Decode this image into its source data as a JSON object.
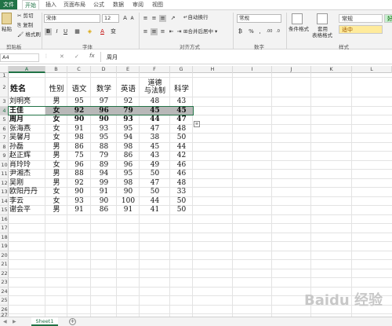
{
  "tabs": [
    "文件",
    "开始",
    "插入",
    "页面布局",
    "公式",
    "数据",
    "审阅",
    "视图"
  ],
  "ribbon": {
    "cut": "剪切",
    "paste": "粘贴",
    "copy": "复制",
    "format_painter": "格式刷",
    "font_name": "宋体",
    "font_size": "12",
    "bold": "B",
    "italic": "I",
    "underline": "U",
    "font_grow": "A",
    "font_shrink": "A",
    "wrap_text": "自动换行",
    "merge_center": "合并后居中",
    "number_format": "常规",
    "percent": "%",
    "comma": ",",
    "conditional_format": "条件格式",
    "table_format_1": "套用",
    "table_format_2": "表格格式",
    "style_normal": "常规",
    "style_good": "好",
    "style_neutral": "适中",
    "group_clipboard": "剪贴板",
    "group_font": "字体",
    "group_alignment": "对齐方式",
    "group_number": "数字",
    "group_styles": "样式"
  },
  "formula_bar": {
    "name_box": "A4",
    "fx": "fx",
    "cancel": "✕",
    "enter": "✓",
    "content": "周月"
  },
  "sheet": {
    "columns": [
      "A",
      "B",
      "C",
      "D",
      "E",
      "F",
      "G",
      "H",
      "I",
      "J",
      "K",
      "L"
    ],
    "rows": [
      "1",
      "2",
      "3",
      "4",
      "5",
      "6",
      "7",
      "8",
      "9",
      "10",
      "11",
      "12",
      "13",
      "14",
      "15",
      "16",
      "17",
      "18",
      "19",
      "20",
      "21",
      "22",
      "23",
      "24",
      "25",
      "26",
      "27"
    ],
    "headers": [
      "姓名",
      "性别",
      "语文",
      "数学",
      "英语",
      "道德\n与法制",
      "科学"
    ],
    "data": [
      [
        "刘明亮",
        "男",
        "95",
        "97",
        "92",
        "48",
        "43"
      ],
      [
        "王佳",
        "女",
        "92",
        "96",
        "79",
        "45",
        "45"
      ],
      [
        "周月",
        "女",
        "90",
        "90",
        "93",
        "44",
        "47"
      ],
      [
        "张海燕",
        "女",
        "91",
        "93",
        "95",
        "47",
        "48"
      ],
      [
        "吴馨月",
        "女",
        "98",
        "95",
        "94",
        "38",
        "50"
      ],
      [
        "孙磊",
        "男",
        "86",
        "88",
        "98",
        "45",
        "44"
      ],
      [
        "赵正辉",
        "男",
        "75",
        "79",
        "86",
        "43",
        "42"
      ],
      [
        "肖玲玲",
        "女",
        "96",
        "89",
        "96",
        "49",
        "46"
      ],
      [
        "尹湘杰",
        "男",
        "88",
        "94",
        "95",
        "50",
        "46"
      ],
      [
        "吴刚",
        "男",
        "92",
        "99",
        "98",
        "47",
        "48"
      ],
      [
        "欧阳丹丹",
        "女",
        "90",
        "91",
        "90",
        "50",
        "33"
      ],
      [
        "李云",
        "女",
        "93",
        "90",
        "100",
        "44",
        "50"
      ],
      [
        "谢会平",
        "男",
        "91",
        "86",
        "91",
        "41",
        "50"
      ]
    ],
    "selected_row_fill": "#b8b8b8",
    "accent": "#217346"
  },
  "sheet_tabs": {
    "sheet1": "Sheet1"
  },
  "watermark": "Baidu 经验"
}
